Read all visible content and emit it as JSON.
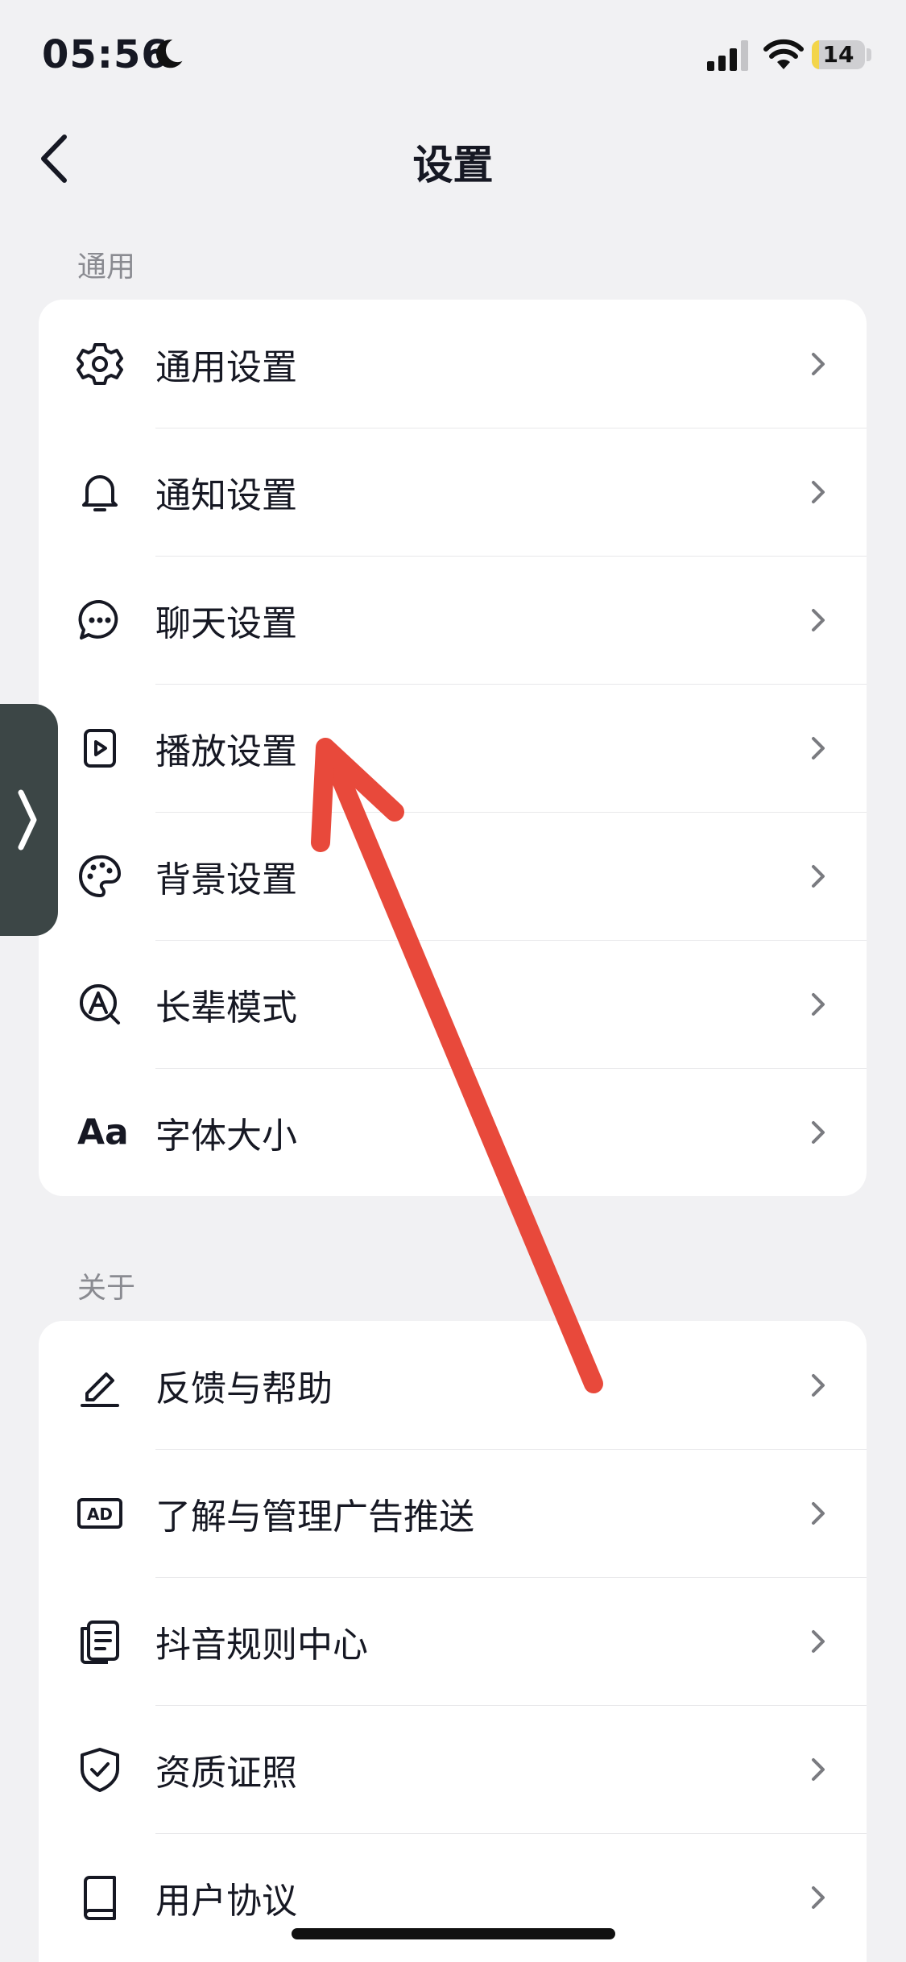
{
  "status_bar": {
    "time": "05:56",
    "battery": "14",
    "battery_fraction": 0.14,
    "battery_color": "#f3d54a"
  },
  "nav": {
    "title": "设置"
  },
  "sections": [
    {
      "label": "通用",
      "items": [
        {
          "label": "通用设置",
          "icon": "gear-icon"
        },
        {
          "label": "通知设置",
          "icon": "bell-icon"
        },
        {
          "label": "聊天设置",
          "icon": "chat-bubble-icon"
        },
        {
          "label": "播放设置",
          "icon": "play-icon"
        },
        {
          "label": "背景设置",
          "icon": "palette-icon"
        },
        {
          "label": "长辈模式",
          "icon": "elder-mode-icon"
        },
        {
          "label": "字体大小",
          "icon": "font-size-icon",
          "icon_text": "Aa"
        }
      ]
    },
    {
      "label": "关于",
      "items": [
        {
          "label": "反馈与帮助",
          "icon": "pencil-icon"
        },
        {
          "label": "了解与管理广告推送",
          "icon": "ad-icon",
          "icon_text": "AD"
        },
        {
          "label": "抖音规则中心",
          "icon": "document-list-icon"
        },
        {
          "label": "资质证照",
          "icon": "shield-check-icon"
        },
        {
          "label": "用户协议",
          "icon": "book-icon"
        }
      ]
    }
  ],
  "annotation": {
    "arrow_color": "#e8493b"
  }
}
